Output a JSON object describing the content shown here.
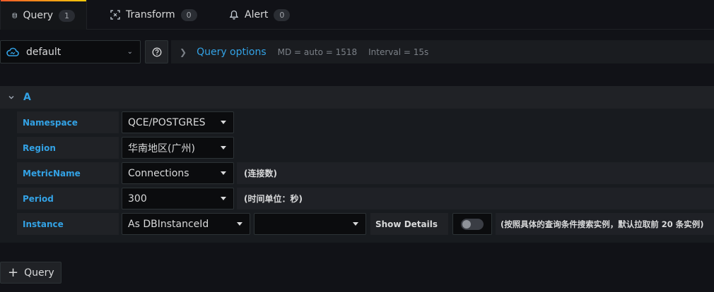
{
  "tabs": [
    {
      "label": "Query",
      "count": "1"
    },
    {
      "label": "Transform",
      "count": "0"
    },
    {
      "label": "Alert",
      "count": "0"
    }
  ],
  "datasource": {
    "name": "default"
  },
  "query_options": {
    "label": "Query options",
    "md": "MD = auto = 1518",
    "interval": "Interval = 15s"
  },
  "query": {
    "ref": "A",
    "rows": [
      {
        "label": "Namespace",
        "value": "QCE/POSTGRES"
      },
      {
        "label": "Region",
        "value": "华南地区(广州)"
      },
      {
        "label": "MetricName",
        "value": "Connections",
        "note": "(连接数)"
      },
      {
        "label": "Period",
        "value": "300",
        "note": "(时间单位：秒)"
      },
      {
        "label": "Instance",
        "value": "As DBInstanceId",
        "value2": "",
        "show_details": "Show Details",
        "note": "(按照具体的查询条件搜索实例，默认拉取前 20 条实例)"
      }
    ]
  },
  "add_query": {
    "label": "Query"
  },
  "colors": {
    "accent": "#33a2e5",
    "background": "#111217"
  }
}
